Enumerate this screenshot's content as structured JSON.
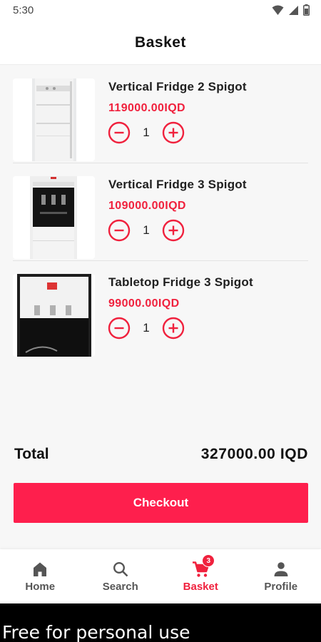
{
  "status_bar": {
    "time": "5:30"
  },
  "header": {
    "title": "Basket"
  },
  "items": [
    {
      "name": "Vertical Fridge 2 Spigot",
      "price": "119000.00IQD",
      "quantity": "1",
      "image_icon": "water-dispenser-white"
    },
    {
      "name": "Vertical Fridge 3 Spigot",
      "price": "109000.00IQD",
      "quantity": "1",
      "image_icon": "water-dispenser-black-panel"
    },
    {
      "name": "Tabletop Fridge 3 Spigot",
      "price": "99000.00IQD",
      "quantity": "1",
      "image_icon": "tabletop-water-dispenser"
    }
  ],
  "summary": {
    "total_label": "Total",
    "total_value": "327000.00 IQD"
  },
  "checkout": {
    "label": "Checkout"
  },
  "bottom_nav": {
    "items": [
      {
        "label": "Home",
        "icon": "home-icon",
        "active": false
      },
      {
        "label": "Search",
        "icon": "search-icon",
        "active": false
      },
      {
        "label": "Basket",
        "icon": "cart-icon",
        "active": true,
        "badge": "3"
      },
      {
        "label": "Profile",
        "icon": "person-icon",
        "active": false
      }
    ]
  },
  "watermark": {
    "text": "Free for personal use"
  },
  "colors": {
    "accent": "#fe1f4d",
    "price": "#f0213d",
    "background": "#f7f7f7"
  }
}
